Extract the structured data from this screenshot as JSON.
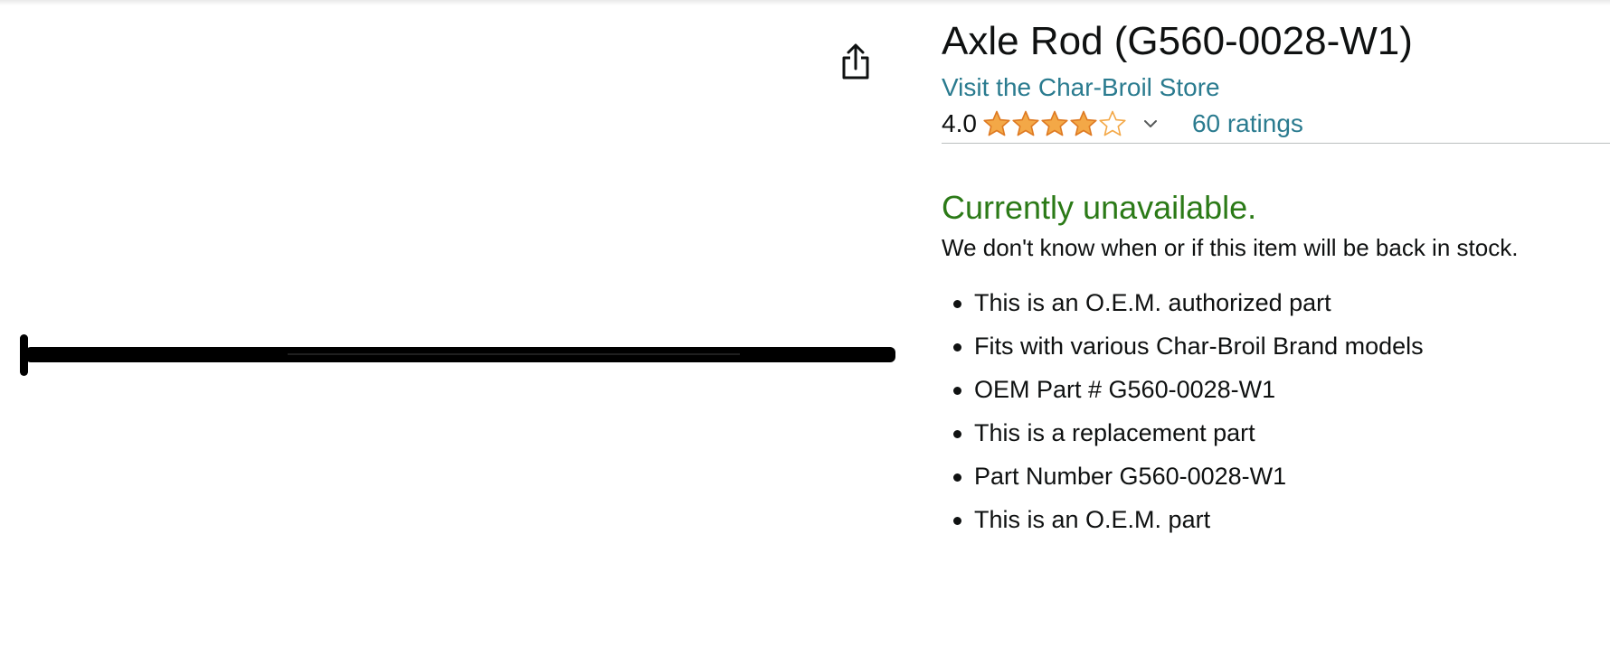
{
  "product": {
    "title": "Axle Rod (G560-0028-W1)",
    "store_link": "Visit the Char-Broil Store",
    "rating": {
      "value": "4.0",
      "stars_filled": 4,
      "stars_total": 5,
      "count_text": "60 ratings"
    },
    "availability": {
      "status": "Currently unavailable.",
      "note": "We don't know when or if this item will be back in stock."
    },
    "bullets": [
      "This is an O.E.M. authorized part",
      "Fits with various Char-Broil Brand models",
      "OEM Part # G560-0028-W1",
      "This is a replacement part",
      "Part Number G560-0028-W1",
      "This is an O.E.M. part"
    ]
  },
  "icons": {
    "share": "share-icon",
    "star_full": "star-full-icon",
    "star_empty": "star-empty-icon",
    "chevron": "chevron-down-icon"
  },
  "colors": {
    "link": "#2a7b8f",
    "availability": "#2b7a17",
    "star": "#f3a847",
    "text": "#0f1111"
  }
}
